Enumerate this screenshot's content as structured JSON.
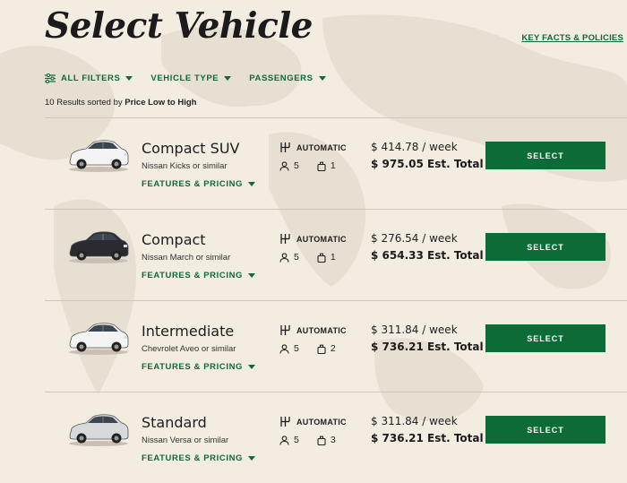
{
  "header": {
    "title": "Select Vehicle",
    "policies_link": "KEY FACTS & POLICIES"
  },
  "filters": {
    "all_filters": "ALL FILTERS",
    "vehicle_type": "VEHICLE TYPE",
    "passengers": "PASSENGERS"
  },
  "results": {
    "prefix": "10 Results sorted by ",
    "sort": "Price Low to High"
  },
  "vehicles": [
    {
      "category": "Compact SUV",
      "model": "Nissan Kicks or similar",
      "features": "FEATURES & PRICING",
      "transmission": "AUTOMATIC",
      "passengers": "5",
      "bags": "1",
      "weekly": "$ 414.78 / week",
      "total": "$ 975.05 Est. Total",
      "select": "SELECT",
      "car_color": "#f4f4f4"
    },
    {
      "category": "Compact",
      "model": "Nissan March or similar",
      "features": "FEATURES & PRICING",
      "transmission": "AUTOMATIC",
      "passengers": "5",
      "bags": "1",
      "weekly": "$ 276.54 / week",
      "total": "$ 654.33 Est. Total",
      "select": "SELECT",
      "car_color": "#2a2a30"
    },
    {
      "category": "Intermediate",
      "model": "Chevrolet Aveo or similar",
      "features": "FEATURES & PRICING",
      "transmission": "AUTOMATIC",
      "passengers": "5",
      "bags": "2",
      "weekly": "$ 311.84 / week",
      "total": "$ 736.21 Est. Total",
      "select": "SELECT",
      "car_color": "#f4f4f4"
    },
    {
      "category": "Standard",
      "model": "Nissan Versa or similar",
      "features": "FEATURES & PRICING",
      "transmission": "AUTOMATIC",
      "passengers": "5",
      "bags": "3",
      "weekly": "$ 311.84 / week",
      "total": "$ 736.21 Est. Total",
      "select": "SELECT",
      "car_color": "#d8d9db"
    }
  ],
  "colors": {
    "accent": "#0c6b37",
    "background": "#f3ece0"
  },
  "icons": {
    "filter": "sliders-icon",
    "transmission": "gear-shift-icon",
    "passengers": "person-icon",
    "bags": "suitcase-icon"
  }
}
